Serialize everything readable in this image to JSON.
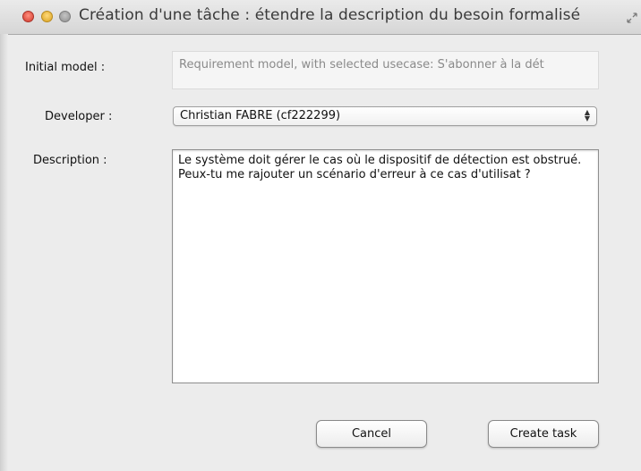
{
  "window": {
    "title": "Création d'une tâche : étendre la description du besoin formalisé"
  },
  "form": {
    "initial_model_label": "Initial model :",
    "initial_model_value": "Requirement model, with selected usecase: S'abonner à la dét",
    "developer_label": "Developer :",
    "developer_selected": "Christian FABRE (cf222299)",
    "description_label": "Description :",
    "description_value": "Le système doit gérer le cas où le dispositif de détection est obstrué. Peux-tu me rajouter un scénario d'erreur à ce cas d'utilisat ?"
  },
  "buttons": {
    "cancel_label": "Cancel",
    "create_label": "Create task"
  },
  "icons": {
    "close": "close-icon",
    "minimize": "minimize-icon",
    "zoom": "zoom-icon",
    "resize": "fullscreen-icon",
    "select_arrows": "updown-arrows-icon"
  }
}
